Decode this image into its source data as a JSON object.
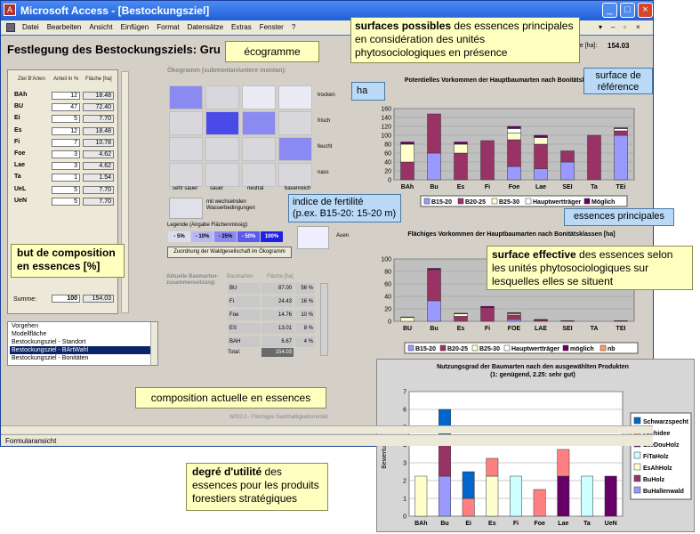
{
  "window": {
    "title": "Microsoft Access - [Bestockungsziel]",
    "icon": "access-icon"
  },
  "menu": [
    "Datei",
    "Bearbeiten",
    "Ansicht",
    "Einfügen",
    "Format",
    "Datensätze",
    "Extras",
    "Fenster",
    "?"
  ],
  "form": {
    "title": "Festlegung des Bestockungsziels: Gru",
    "ref_label": "ne [ha]:",
    "ref_value": "154.03"
  },
  "targets": {
    "header": {
      "col1": "Ziel B'Arten",
      "col2": "Anteil in %",
      "col3": "Fläche [ha]"
    },
    "rows": [
      {
        "name": "BAh",
        "pct": "12",
        "area": "18.48"
      },
      {
        "name": "BU",
        "pct": "47",
        "area": "72.40"
      },
      {
        "name": "Ei",
        "pct": "5",
        "area": "7.70"
      },
      {
        "name": "Es",
        "pct": "12",
        "area": "18.48"
      },
      {
        "name": "Fi",
        "pct": "7",
        "area": "10.78"
      },
      {
        "name": "Foe",
        "pct": "3",
        "area": "4.62"
      },
      {
        "name": "Lae",
        "pct": "3",
        "area": "4.62"
      },
      {
        "name": "Ta",
        "pct": "1",
        "area": "1.54"
      },
      {
        "name": "UeL",
        "pct": "5",
        "area": "7.70"
      },
      {
        "name": "UeN",
        "pct": "5",
        "area": "7.70"
      }
    ],
    "sum_label": "Summe:",
    "sum_pct": "100",
    "sum_area": "154.03"
  },
  "list": [
    "Vorgehen",
    "Modellfläche",
    "Bestockungsziel - Standort",
    "Bestockungsziel - BArtWahl",
    "Bestockungsziel - Bonitäten"
  ],
  "list_selected": 3,
  "oekogramm": {
    "title": "Ökogramm (submontan/untere montan):",
    "row_labels": [
      "trocken",
      "frisch",
      "feucht",
      "nass"
    ],
    "col_labels": [
      "sehr sauer",
      "sauer",
      "neutral",
      "basenreich"
    ],
    "cells": [
      [
        "#8a8af2",
        "#d8d8dc",
        "#eaeaf5",
        "#eaeaf5"
      ],
      [
        "#d8d8dc",
        "#4a4ae8",
        "#8a8af2",
        "#d8d8dc"
      ],
      [
        "#d8d8dc",
        "#d8d8dc",
        "#d8d8dc",
        "#8a8af2"
      ],
      [
        "#d8d8dc",
        "#d8d8dc",
        "#d8d8dc",
        "#d8d8dc"
      ]
    ],
    "wechsel_label": "mit wechselnden Wasserbedingungen",
    "legend_title": "Legende (Angabe Flächenmissig):",
    "legend": [
      {
        "label": "- 5%",
        "color": "#dcdcf0"
      },
      {
        "label": "- 10%",
        "color": "#b8b8f4"
      },
      {
        "label": "- 25%",
        "color": "#8a8af2"
      },
      {
        "label": "- 50%",
        "color": "#5a5aec"
      },
      {
        "label": "100%",
        "color": "#2020e0"
      }
    ],
    "auen_label": "Auen",
    "zuordnung_button": "Zuordnung der Waldgesellschaft im Ökogramm"
  },
  "current": {
    "title": "Aktuelle Baumarten-zusammensetzung:",
    "header": {
      "col1": "Baumarten",
      "col2": "Fläche [ha]"
    },
    "rows": [
      {
        "name": "BU",
        "area": "87.00",
        "pct": "56 %"
      },
      {
        "name": "Fi",
        "area": "24.43",
        "pct": "16 %"
      },
      {
        "name": "Foe",
        "area": "14.76",
        "pct": "10 %"
      },
      {
        "name": "ES",
        "area": "13.01",
        "pct": "8 %"
      },
      {
        "name": "BAH",
        "area": "6.67",
        "pct": "4 %"
      }
    ],
    "total_label": "Total:",
    "total_value": "154.03"
  },
  "footer_text": "WIS2.0 - Flächiges Nachhaltigkeitsmodell",
  "status": "Formularansicht",
  "callouts": {
    "oekogramme": "écogramme",
    "possibles_bold": "surfaces possibles",
    "possibles_rest": " des essences principales en considération des unités phytosociologiques en présence",
    "reference": "surface de référence",
    "ha": "ha",
    "fertilite_l1": "indice de fertilité",
    "fertilite_l2": "(p.ex. B15-20: 15-20 m)",
    "principales": "essences principales",
    "effective_bold": "surface effective",
    "effective_rest": " des essences selon les unités phytosociologiques sur lesquelles elles se situent",
    "but_l1": "but de composition",
    "but_l2": "en essences [%]",
    "actuelle": "composition actuelle en essences",
    "utilite_bold": "degré d'utilité",
    "utilite_rest": " des essences pour les produits forestiers stratégiques"
  },
  "chart_data": [
    {
      "type": "bar",
      "title": "Potentielles Vorkommen der Hauptbaumarten nach Bonitätsklassen [ha]",
      "categories": [
        "BAh",
        "Bu",
        "Es",
        "Fi",
        "Foe",
        "Lae",
        "SEI",
        "Ta",
        "TEi"
      ],
      "ylim": [
        0,
        160
      ],
      "yticks": [
        0,
        20,
        40,
        60,
        80,
        100,
        120,
        140,
        160
      ],
      "series": [
        {
          "name": "B15-20",
          "color": "#9999ff",
          "values": [
            0,
            60,
            0,
            0,
            30,
            25,
            40,
            0,
            100
          ]
        },
        {
          "name": "B20-25",
          "color": "#993366",
          "values": [
            40,
            88,
            60,
            88,
            60,
            55,
            25,
            100,
            10
          ]
        },
        {
          "name": "B25-30",
          "color": "#ffffcc",
          "values": [
            40,
            0,
            20,
            0,
            15,
            15,
            0,
            0,
            0
          ]
        },
        {
          "name": "Hauptwertträger",
          "color": "#ffffff",
          "values": [
            0,
            0,
            0,
            0,
            10,
            0,
            0,
            0,
            5
          ]
        },
        {
          "name": "Möglich",
          "color": "#660066",
          "values": [
            5,
            0,
            5,
            0,
            5,
            5,
            0,
            0,
            2
          ]
        }
      ]
    },
    {
      "type": "bar",
      "title": "Flächiges Vorkommen der Hauptbaumarten nach Bonitätsklassen [ha]",
      "categories": [
        "BU",
        "Bu",
        "Es",
        "Fi",
        "FOE",
        "LAE",
        "SEI",
        "TA",
        "TEI"
      ],
      "ylim": [
        0,
        100
      ],
      "yticks": [
        0,
        20,
        40,
        60,
        80,
        100
      ],
      "series": [
        {
          "name": "B15-20",
          "color": "#9999ff",
          "values": [
            0,
            33,
            0,
            0,
            3,
            0,
            0,
            0,
            0
          ]
        },
        {
          "name": "B20-25",
          "color": "#993366",
          "values": [
            0,
            50,
            8,
            22,
            7,
            2,
            0,
            0,
            0
          ]
        },
        {
          "name": "B25-30",
          "color": "#ffffcc",
          "values": [
            6,
            0,
            4,
            0,
            2,
            0,
            0,
            0,
            0
          ]
        },
        {
          "name": "Hauptwertträger",
          "color": "#ffffff",
          "values": [
            0,
            0,
            0,
            0,
            1,
            0,
            0,
            0,
            0
          ]
        },
        {
          "name": "möglich",
          "color": "#660066",
          "values": [
            1,
            2,
            1,
            2,
            1,
            1,
            1,
            0,
            1
          ]
        },
        {
          "name": "nb",
          "color": "#ff9966",
          "values": [
            0,
            0,
            0,
            0,
            0,
            0,
            0,
            0,
            0
          ]
        }
      ]
    },
    {
      "type": "bar",
      "title": "Nutzungsgrad der Baumarten nach den ausgewählten Produkten",
      "subtitle": "(1: genügend, 2.25: sehr gut)",
      "ylabel": "Bewertung",
      "categories": [
        "BAh",
        "Bu",
        "Ei",
        "Es",
        "Fi",
        "Foe",
        "Lae",
        "Ta",
        "UeN"
      ],
      "ylim": [
        0,
        7
      ],
      "yticks": [
        0,
        1,
        2,
        3,
        4,
        5,
        6,
        7
      ],
      "series": [
        {
          "name": "BuHallenwald",
          "color": "#9999ff",
          "values": [
            0,
            2.25,
            0,
            0,
            0,
            0,
            0,
            0,
            0
          ]
        },
        {
          "name": "BuHolz",
          "color": "#993366",
          "values": [
            0,
            2.25,
            0,
            0,
            0,
            0,
            0,
            0,
            0
          ]
        },
        {
          "name": "EsAhHolz",
          "color": "#ffffcc",
          "values": [
            2.25,
            0,
            0,
            2.25,
            0,
            0,
            0,
            0,
            0
          ]
        },
        {
          "name": "FiTaHolz",
          "color": "#ccffff",
          "values": [
            0,
            0,
            0,
            0,
            2.25,
            0,
            0,
            2.25,
            0
          ]
        },
        {
          "name": "LaeDouHolz",
          "color": "#660066",
          "values": [
            0,
            0,
            0,
            0,
            0,
            0,
            2.25,
            0,
            2.25
          ]
        },
        {
          "name": "Orchidee",
          "color": "#ff8080",
          "values": [
            0,
            0,
            1,
            1,
            0,
            1.5,
            1.5,
            0,
            0
          ]
        },
        {
          "name": "Schwarzspecht",
          "color": "#0066cc",
          "values": [
            0,
            1.5,
            1.5,
            0,
            0,
            0,
            0,
            0,
            0
          ]
        }
      ]
    }
  ]
}
